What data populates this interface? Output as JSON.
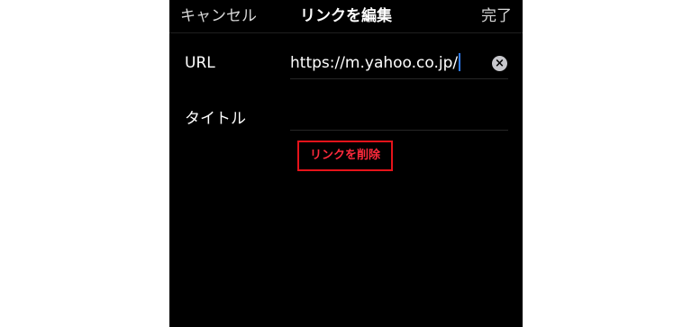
{
  "navbar": {
    "cancel_label": "キャンセル",
    "title": "リンクを編集",
    "done_label": "完了"
  },
  "form": {
    "url_label": "URL",
    "url_value": "https://m.yahoo.co.jp/",
    "title_label": "タイトル",
    "title_value": ""
  },
  "actions": {
    "delete_link_label": "リンクを削除"
  },
  "colors": {
    "background": "#000000",
    "text": "#ffffff",
    "destructive": "#ff2a3c",
    "highlight_box": "#e5131a",
    "caret": "#2f7cf6"
  },
  "icons": {
    "clear": "clear-circle-icon"
  }
}
